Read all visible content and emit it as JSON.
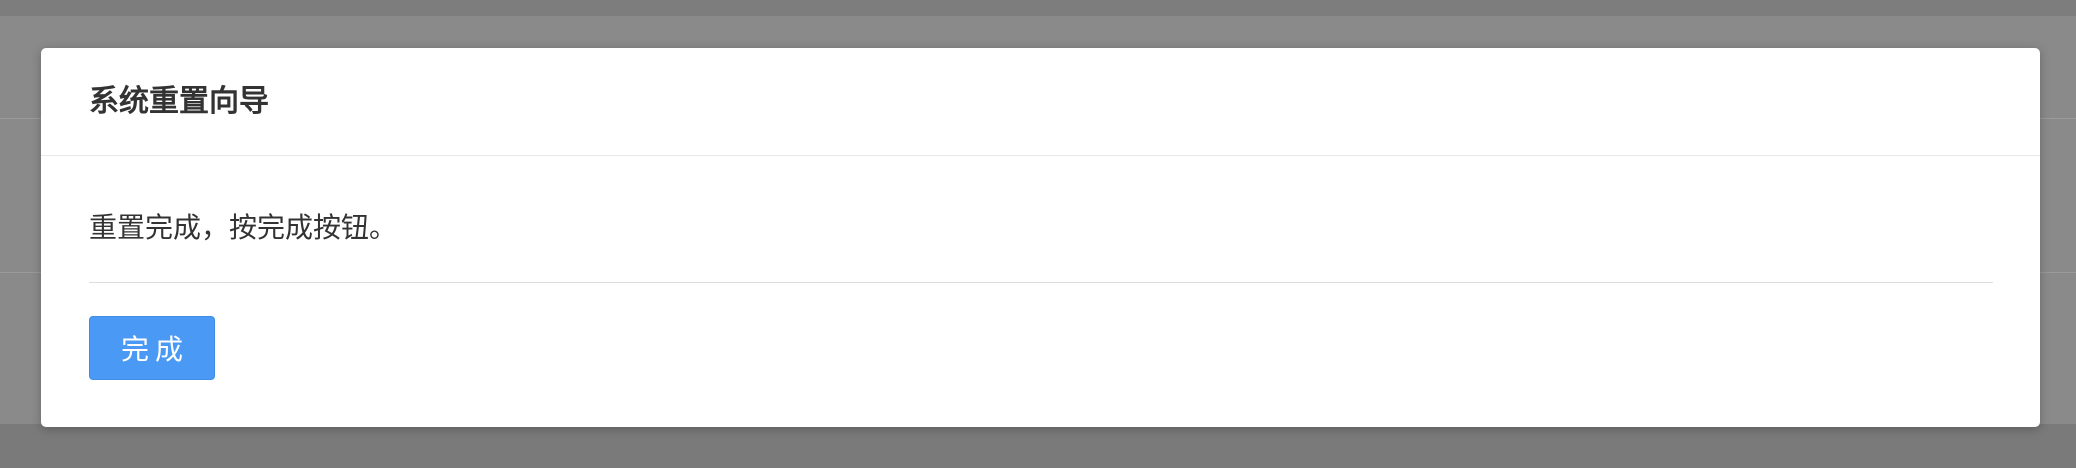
{
  "dialog": {
    "title": "系统重置向导",
    "message": "重置完成，按完成按钮。",
    "done_button_label": "完成"
  },
  "colors": {
    "overlay": "#8a8a8a",
    "dialog_background": "#ffffff",
    "primary_button": "#4a9af5",
    "text": "#333333"
  }
}
